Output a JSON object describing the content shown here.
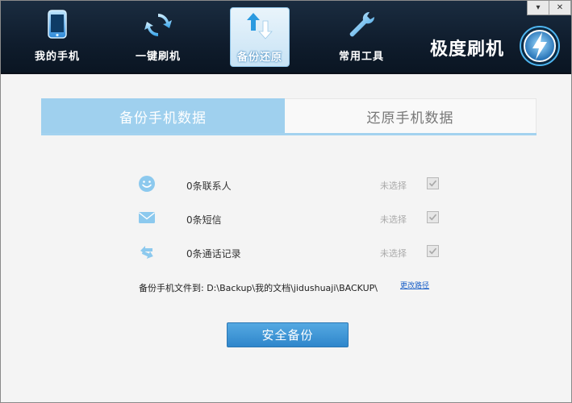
{
  "nav": {
    "items": [
      {
        "label": "我的手机",
        "icon": "phone-icon"
      },
      {
        "label": "一键刷机",
        "icon": "refresh-icon"
      },
      {
        "label": "备份还原",
        "icon": "backup-restore-icon",
        "active": true
      },
      {
        "label": "常用工具",
        "icon": "wrench-icon"
      }
    ]
  },
  "brand": {
    "name": "极度刷机",
    "icon": "lightning-logo-icon"
  },
  "window": {
    "menu_icon": "dropdown-menu-icon",
    "close_icon": "close-icon"
  },
  "tabs": {
    "backup": "备份手机数据",
    "restore": "还原手机数据",
    "active": "backup"
  },
  "rows": [
    {
      "icon": "smile-icon",
      "label": "0条联系人",
      "state": "未选择",
      "checked": true
    },
    {
      "icon": "mail-icon",
      "label": "0条短信",
      "state": "未选择",
      "checked": true
    },
    {
      "icon": "call-log-icon",
      "label": "0条通话记录",
      "state": "未选择",
      "checked": true
    }
  ],
  "backup_path": {
    "label": "备份手机文件到: D:\\Backup\\我的文档\\jidushuaji\\BACKUP\\",
    "change_link": "更改路径"
  },
  "action": {
    "label": "安全备份"
  },
  "colors": {
    "header_bg": "#13233a",
    "accent": "#9fd0ee",
    "button": "#3b92d6",
    "link": "#1a5fc7"
  }
}
